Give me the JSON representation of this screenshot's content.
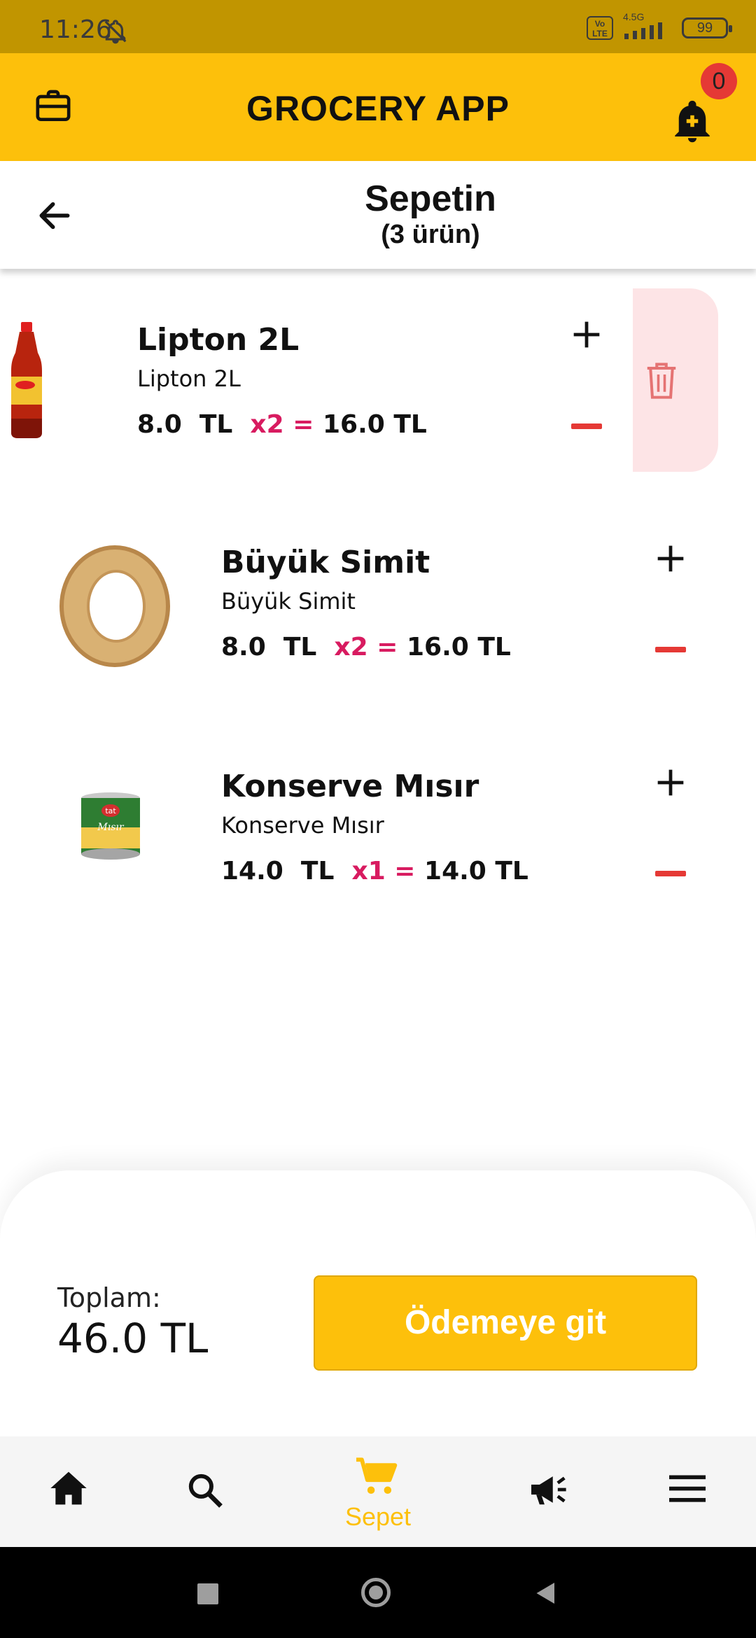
{
  "status_bar": {
    "time": "11:26",
    "network": "4.5G",
    "volte": "Vo LTE",
    "battery": "99"
  },
  "app_bar": {
    "title": "GROCERY APP",
    "notification_count": "0"
  },
  "cart_header": {
    "title": "Sepetin",
    "count": "(3 ürün)"
  },
  "cart_items": [
    {
      "name": "Lipton 2L",
      "description": "Lipton 2L",
      "price": "8.0  TL",
      "quantity": "x2",
      "equals": "=",
      "line_total": "16.0 TL"
    },
    {
      "name": "Büyük Simit",
      "description": "Büyük Simit",
      "price": "8.0  TL",
      "quantity": "x2",
      "equals": "=",
      "line_total": "16.0 TL"
    },
    {
      "name": "Konserve Mısır",
      "description": "Konserve Mısır",
      "price": "14.0  TL",
      "quantity": "x1",
      "equals": "=",
      "line_total": "14.0 TL"
    }
  ],
  "checkout": {
    "total_label": "Toplam:",
    "total_value": "46.0 TL",
    "button_label": "Ödemeye git"
  },
  "bottom_nav": {
    "active_label": "Sepet",
    "items": [
      "home-icon",
      "search-icon",
      "cart-icon",
      "megaphone-icon",
      "menu-icon"
    ]
  },
  "colors": {
    "primary": "#fdc00b",
    "status_bar": "#c19500",
    "accent_pink": "#d81b60",
    "minus_red": "#e53935",
    "delete_bg": "#fde4e6"
  },
  "image_labels": {
    "can_brand": "tat",
    "can_product": "Mısır"
  }
}
